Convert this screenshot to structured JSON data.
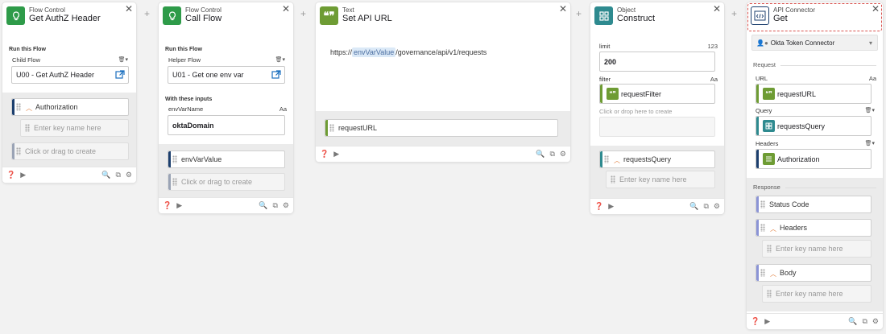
{
  "cards": {
    "authz": {
      "type": "Flow Control",
      "name": "Get AuthZ Header",
      "section": "Run this Flow",
      "child_flow_label": "Child Flow",
      "child_flow_value": "U00 - Get AuthZ Header",
      "output_key": "Authorization",
      "key_placeholder": "Enter key name here",
      "create_placeholder": "Click or drag to create"
    },
    "call": {
      "type": "Flow Control",
      "name": "Call Flow",
      "section": "Run this Flow",
      "helper_flow_label": "Helper Flow",
      "helper_flow_value": "U01 - Get one env var",
      "inputs_section": "With these inputs",
      "input_label": "envVarName",
      "input_type": "Aa",
      "input_value": "oktaDomain",
      "output_key": "envVarValue",
      "create_placeholder": "Click or drag to create"
    },
    "text": {
      "type": "Text",
      "name": "Set API URL",
      "url_prefix": "https://",
      "url_token": "envVarValue",
      "url_suffix": "/governance/api/v1/requests",
      "output_key": "requestURL"
    },
    "object": {
      "type": "Object",
      "name": "Construct",
      "limit_label": "limit",
      "limit_type": "123",
      "limit_value": "200",
      "filter_label": "filter",
      "filter_type": "Aa",
      "filter_value": "requestFilter",
      "drop_placeholder": "Click or drop here to create",
      "output_key": "requestsQuery",
      "key_placeholder": "Enter key name here"
    },
    "api": {
      "type": "API Connector",
      "name": "Get",
      "connection": "Okta Token Connector",
      "request_section": "Request",
      "url_label": "URL",
      "url_type": "Aa",
      "url_value": "requestURL",
      "query_label": "Query",
      "query_value": "requestsQuery",
      "headers_label": "Headers",
      "headers_value": "Authorization",
      "response_section": "Response",
      "status_code": "Status Code",
      "resp_headers": "Headers",
      "resp_body": "Body",
      "key_placeholder": "Enter key name here"
    }
  },
  "colors": {
    "flow_control": "#2e9b49",
    "text_card": "#6e9c34",
    "object_card": "#2e8a8f",
    "api_card": "#1c3f6e",
    "selection_outline": "#d9534f",
    "token_bg": "#dbe9f7"
  },
  "icons": [
    "lightbulb-icon",
    "quote-icon",
    "object-icon",
    "code-icon",
    "close-icon",
    "help-icon",
    "play-icon",
    "search-icon",
    "copy-icon",
    "gear-icon",
    "external-link-icon",
    "trash-icon",
    "chevron-up-icon",
    "plus-icon"
  ]
}
